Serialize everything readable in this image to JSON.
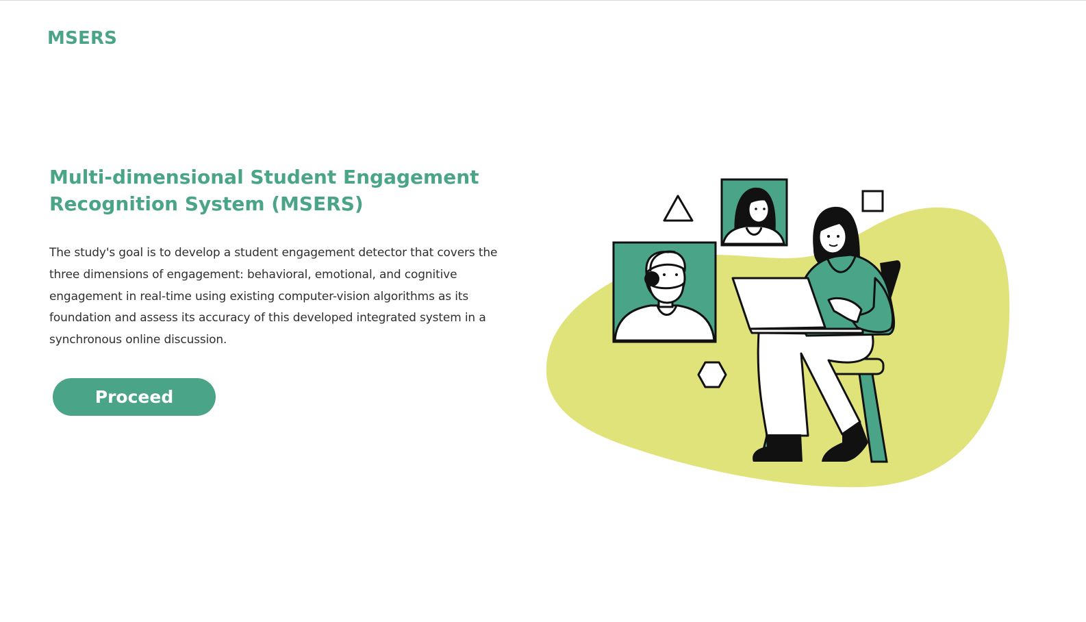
{
  "header": {
    "logo_text": "MSERS"
  },
  "hero": {
    "title": "Multi-dimensional Student Engagement Recognition System (MSERS)",
    "description": "The study's goal is to develop a student engagement detector that covers the three dimensions of engagement: behavioral, emotional, and cognitive engagement in real-time using existing computer-vision algorithms as its foundation and assess its accuracy of this developed integrated system in a synchronous online discussion.",
    "cta_label": "Proceed"
  },
  "illustration": {
    "icon": "video-call-illustration"
  },
  "colors": {
    "brand_green": "#4aa488",
    "blob_yellow": "#e0e37a",
    "text_dark": "#2f2f2f"
  }
}
